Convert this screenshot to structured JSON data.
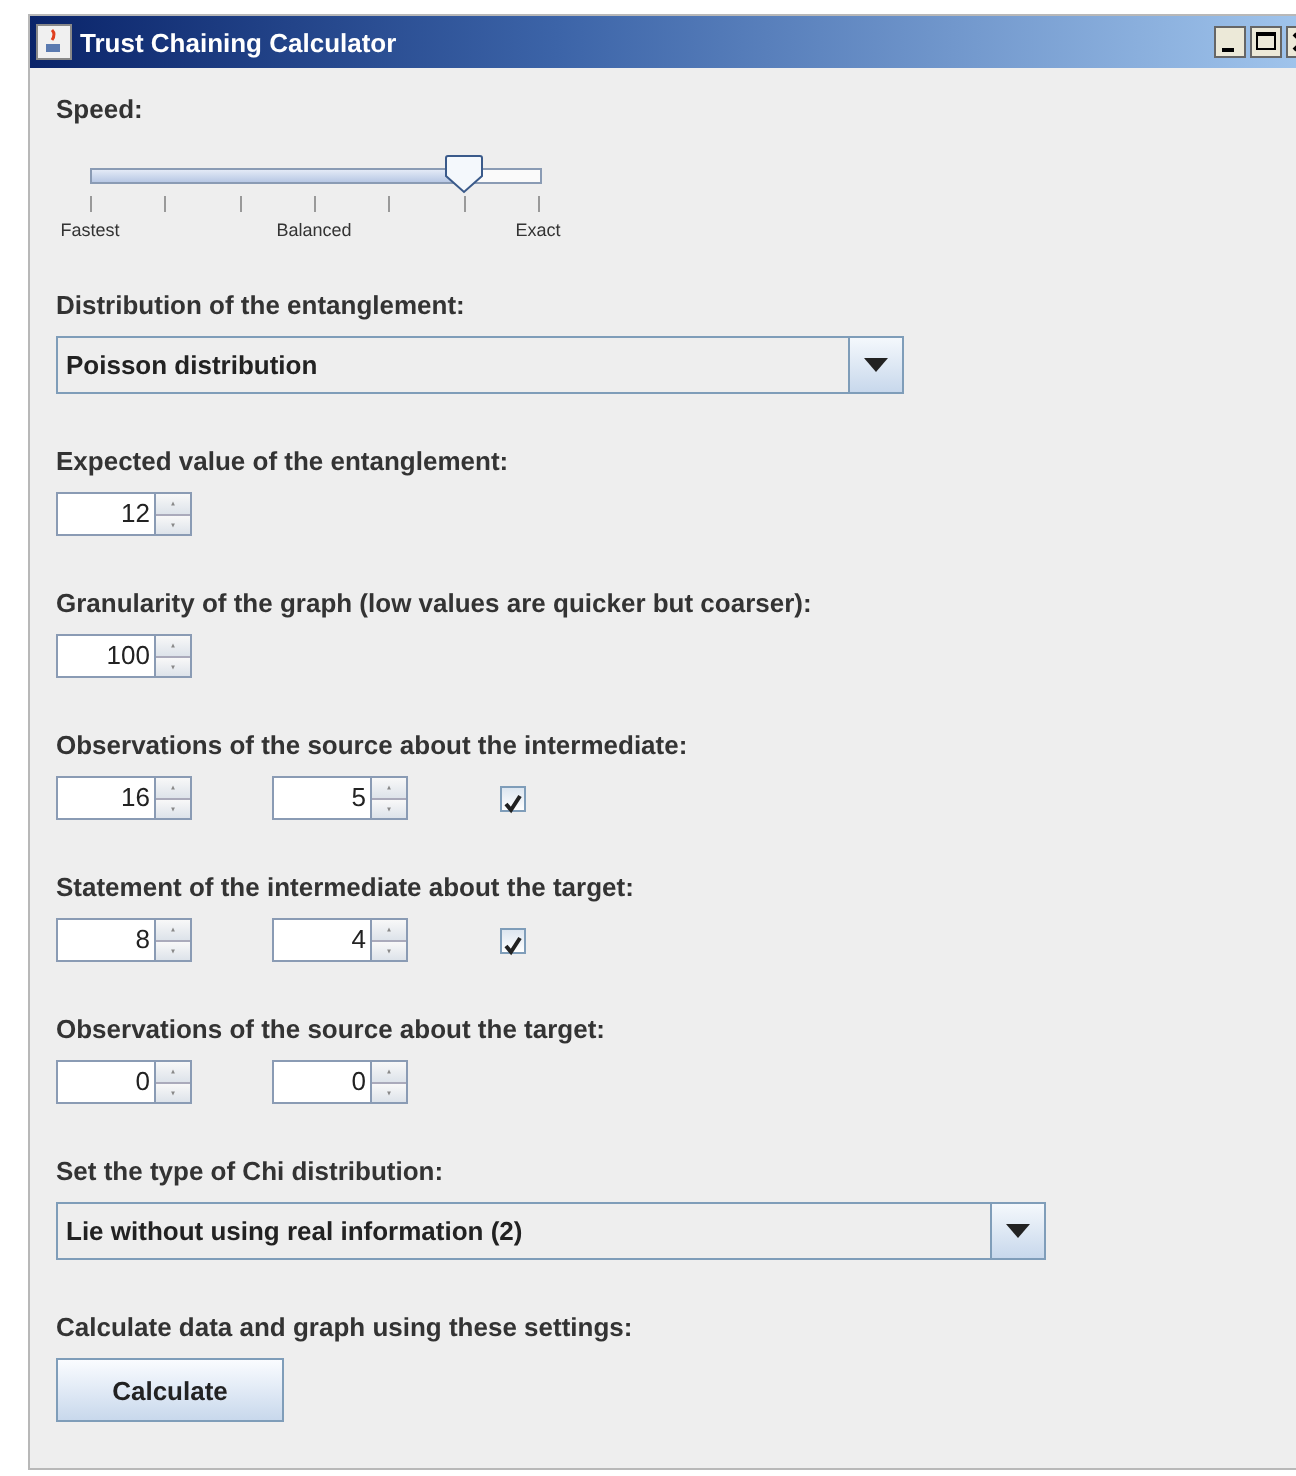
{
  "window": {
    "title": "Trust Chaining Calculator"
  },
  "sections": [
    {
      "kind": "slider",
      "label": "Speed:",
      "level": 0.833,
      "tick_labels": [
        "Fastest",
        "Balanced",
        "Exact"
      ]
    },
    {
      "kind": "dropdown",
      "label": "Distribution of the entanglement:",
      "value": "Poisson distribution",
      "wide": false
    },
    {
      "kind": "spinners",
      "label": "Expected value of the entanglement:",
      "spinners": [
        "12"
      ]
    },
    {
      "kind": "spinners",
      "label": "Granularity of the graph (low values are quicker but coarser):",
      "spinners": [
        "100"
      ]
    },
    {
      "kind": "spinners",
      "label": "Observations of the source about the intermediate:",
      "spinners": [
        "16",
        "5"
      ],
      "checkbox": {
        "checked": true
      }
    },
    {
      "kind": "spinners",
      "label": "Statement of the intermediate about the target:",
      "spinners": [
        "8",
        "4"
      ],
      "checkbox": {
        "checked": true
      }
    },
    {
      "kind": "spinners",
      "label": "Observations of the source about the target:",
      "spinners": [
        "0",
        "0"
      ]
    },
    {
      "kind": "dropdown",
      "label": "Set the type of Chi distribution:",
      "value": "Lie without using real information (2)",
      "wide": true
    },
    {
      "kind": "button",
      "label": "Calculate data and graph using these settings:",
      "button": "Calculate"
    }
  ]
}
